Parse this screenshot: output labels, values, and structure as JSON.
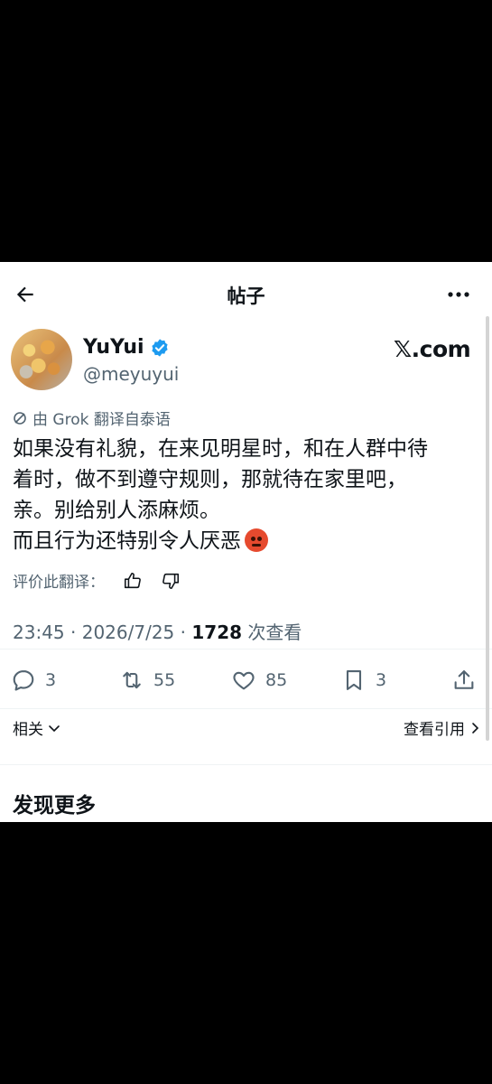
{
  "header": {
    "title": "帖子",
    "back_icon": "arrow-left-icon",
    "more_icon": "more-horizontal-icon"
  },
  "author": {
    "name": "YuYui",
    "handle": "@meyuyui",
    "verified": true,
    "brand_text": "𝕏.com"
  },
  "translation": {
    "grok_label": "由 Grok 翻译自泰语",
    "rate_label": "评价此翻译："
  },
  "post": {
    "lines": [
      "如果没有礼貌，在来见明星时，和在人群中待",
      "着时，做不到遵守规则，那就待在家里吧，",
      "亲。别给别人添麻烦。",
      "而且行为还特别令人厌恶"
    ],
    "emoji": "angry-face"
  },
  "meta": {
    "time": "23:45",
    "separator": "·",
    "date": "2026/7/25",
    "views_count": "1728",
    "views_label": "次查看"
  },
  "actions": {
    "replies": "3",
    "reposts": "55",
    "likes": "85",
    "bookmarks": "3"
  },
  "related": {
    "label": "相关",
    "quotes_label": "查看引用"
  },
  "discover": {
    "title": "发现更多"
  },
  "colors": {
    "text": "#0f1419",
    "secondary": "#536471",
    "verified": "#1d9bf0"
  }
}
